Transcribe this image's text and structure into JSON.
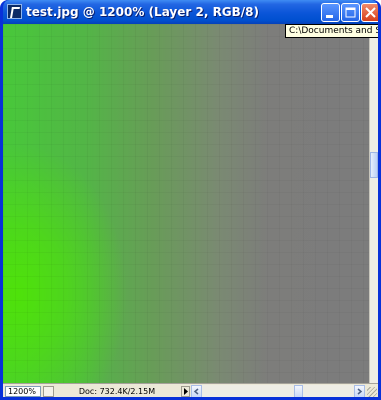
{
  "window": {
    "title": "test.jpg @ 1200% (Layer 2, RGB/8)",
    "icon": "photoshop-document-icon",
    "controls": [
      "minimize-icon",
      "maximize-icon",
      "close-icon"
    ]
  },
  "tooltip": {
    "text": "C:\\Documents and Settings"
  },
  "statusbar": {
    "zoom": "1200%",
    "doc_info": "Doc: 732.4K/2.15M"
  },
  "colors": {
    "titlebar": "#0a55d8",
    "canvas_green": "#4ee20a",
    "canvas_gray": "#7c7c7c"
  }
}
